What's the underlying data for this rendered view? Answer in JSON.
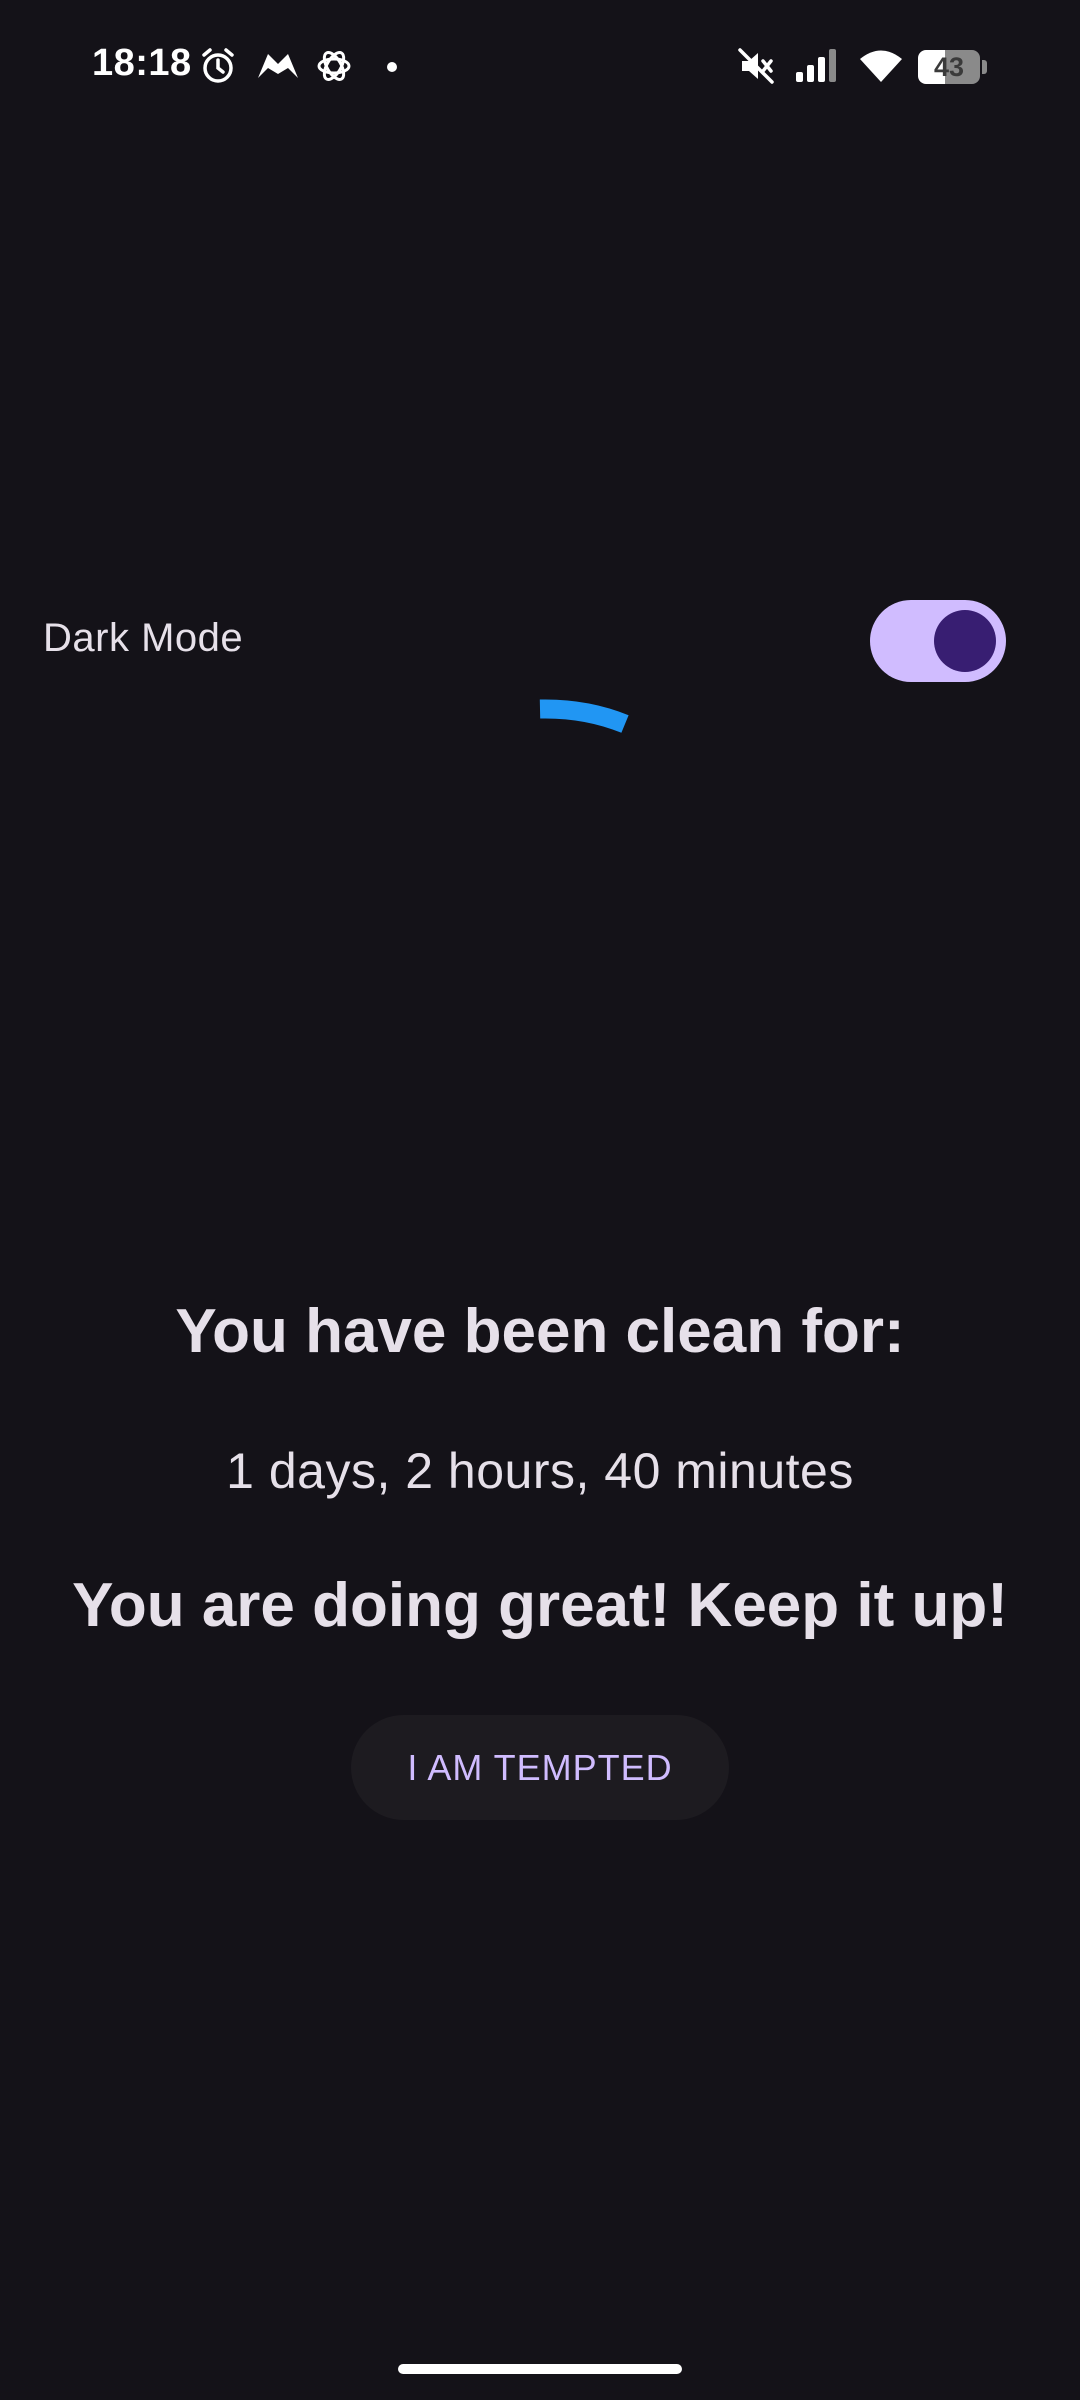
{
  "status_bar": {
    "time": "18:18",
    "battery_level": "43",
    "battery_fraction": 0.43,
    "icons": [
      "alarm-icon",
      "app-notification-icon",
      "chatgpt-icon",
      "notification-dot-icon",
      "mute-icon",
      "signal-icon",
      "wifi-icon",
      "battery-icon"
    ]
  },
  "settings": {
    "dark_mode_label": "Dark Mode",
    "dark_mode_on": true
  },
  "main": {
    "headline": "You have been clean for:",
    "duration": "1 days, 2 hours, 40 minutes",
    "encouragement": "You are doing great! Keep it up!",
    "tempted_button_label": "I AM TEMPTED"
  },
  "colors": {
    "background": "#141218",
    "text": "#e6e0e9",
    "accent": "#d0bcff",
    "toggle_thumb": "#381e72",
    "spinner": "#2196f3",
    "button_bg": "#1d1b20"
  }
}
